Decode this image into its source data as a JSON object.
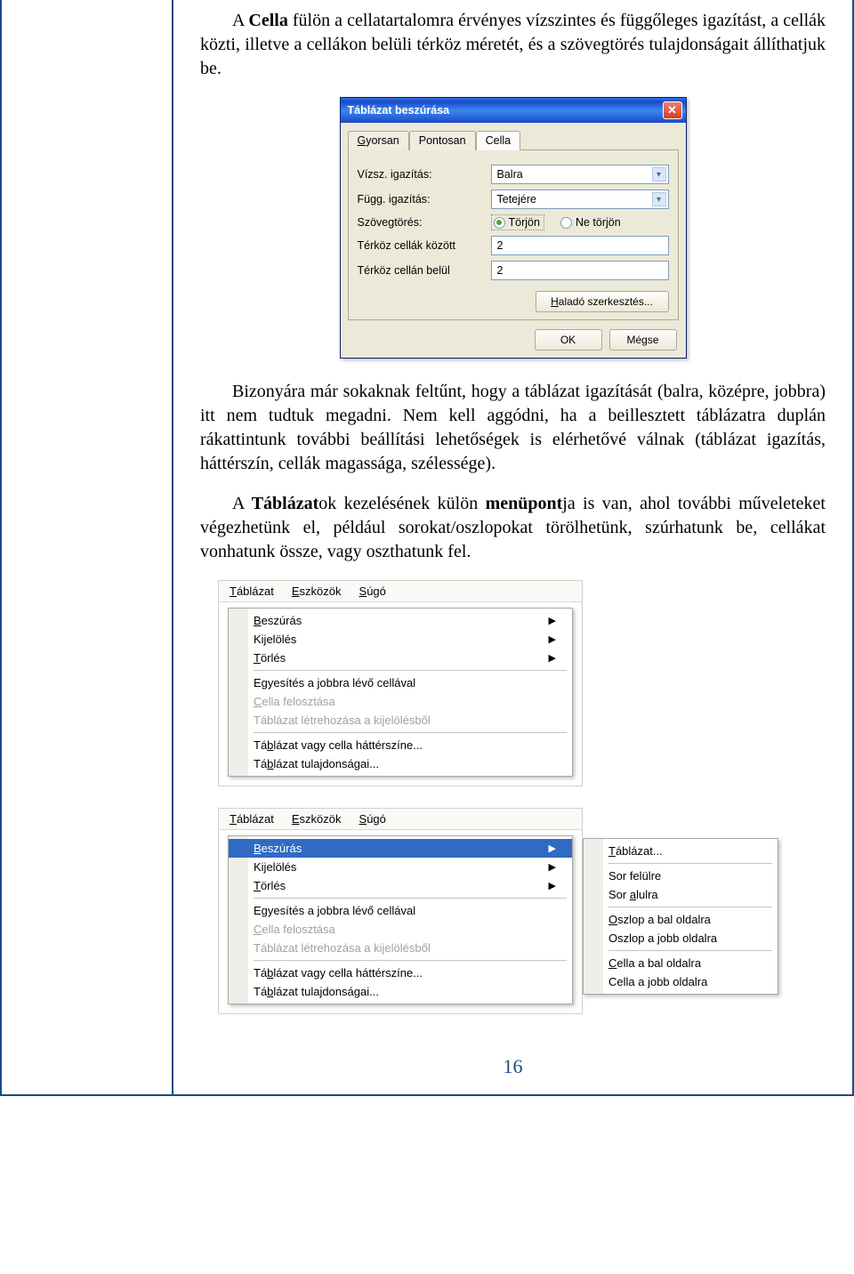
{
  "para1": {
    "pre": "A ",
    "b1": "Cella",
    "post": " fülön a cellatartalomra érvényes vízszintes és függőleges igazítást, a cellák közti, illetve a cellákon belüli térköz méretét, és a szövegtörés tulajdonságait állíthatjuk be."
  },
  "para2": "Bizonyára már sokaknak feltűnt, hogy a táblázat igazítását (balra, középre, jobbra) itt nem tudtuk megadni. Nem kell aggódni, ha a beillesztett táblázatra duplán rákattintunk további beállítási lehetőségek is elérhetővé válnak (táblázat igazítás, háttérszín, cellák magassága, szélessége).",
  "para3": {
    "pre": "A ",
    "b1": "Táblázat",
    "mid1": "ok kezelésének külön ",
    "b2": "menüpont",
    "post": "ja is van, ahol további műveleteket végezhetünk el, például sorokat/oszlopokat törölhetünk, szúrhatunk be, cellákat vonhatunk össze, vagy oszthatunk fel."
  },
  "dialog": {
    "title": "Táblázat beszúrása",
    "tabs": {
      "t1": "Gyorsan",
      "t2": "Pontosan",
      "t3": "Cella"
    },
    "fields": {
      "horiz_label": "Vízsz. igazítás:",
      "horiz_value": "Balra",
      "vert_label": "Függ. igazítás:",
      "vert_value": "Tetejére",
      "wrap_label": "Szövegtörés:",
      "wrap_yes": "Törjön",
      "wrap_no": "Ne törjön",
      "gap_between_label": "Térköz cellák között",
      "gap_between_value": "2",
      "gap_inside_label": "Térköz cellán belül",
      "gap_inside_value": "2"
    },
    "adv_btn": "Haladó szerkesztés...",
    "ok": "OK",
    "cancel": "Mégse"
  },
  "menubar": {
    "m1": "Táblázat",
    "m2": "Eszközök",
    "m3": "Súgó"
  },
  "menu1": {
    "i1": "Beszúrás",
    "i2": "Kijelölés",
    "i3": "Törlés",
    "i4": "Egyesítés a jobbra lévő cellával",
    "i5": "Cella felosztása",
    "i6": "Táblázat létrehozása a kijelölésből",
    "i7": "Táblázat vagy cella háttérszíne...",
    "i8": "Táblázat tulajdonságai..."
  },
  "submenu": {
    "s1": "Táblázat...",
    "s2": "Sor felülre",
    "s3": "Sor alulra",
    "s4": "Oszlop a bal oldalra",
    "s5": "Oszlop a jobb oldalra",
    "s6": "Cella a bal oldalra",
    "s7": "Cella a jobb oldalra"
  },
  "pagenum": "16"
}
